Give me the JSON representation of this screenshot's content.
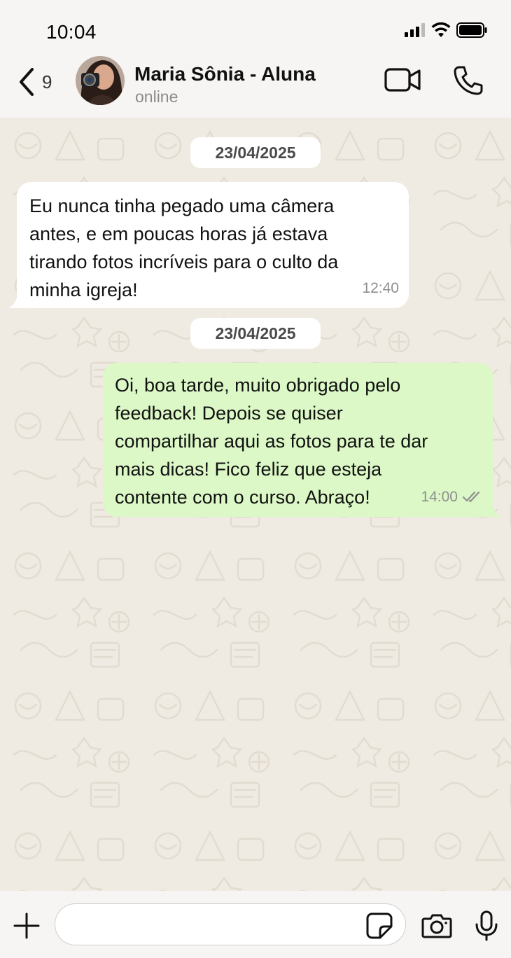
{
  "status_bar": {
    "time": "10:04"
  },
  "header": {
    "back_count": "9",
    "contact_name": "Maria Sônia - Aluna",
    "contact_status": "online"
  },
  "chat": {
    "messages": [
      {
        "date": "23/04/2025",
        "direction": "incoming",
        "text": "Eu nunca tinha pegado uma câmera\nantes, e em poucas horas já estava\ntirando fotos incríveis para o culto da\nminha igreja!",
        "time": "12:40"
      },
      {
        "date": "23/04/2025",
        "direction": "outgoing",
        "text": "Oi, boa tarde, muito obrigado pelo\nfeedback! Depois se quiser\ncompartilhar aqui as fotos para te dar\nmais dicas! Fico feliz que esteja\ncontente com o curso. Abraço!",
        "time": "14:00",
        "status": "read"
      }
    ]
  },
  "composer": {
    "placeholder": ""
  },
  "colors": {
    "incoming_bubble": "#ffffff",
    "outgoing_bubble": "#dbf8c6",
    "chat_bg": "#efeae2",
    "read_ticks": "#8f8f8f"
  },
  "icons": [
    "back-chevron",
    "video-camera",
    "phone",
    "plus",
    "sticker",
    "camera",
    "microphone",
    "read-receipt-double-check"
  ]
}
